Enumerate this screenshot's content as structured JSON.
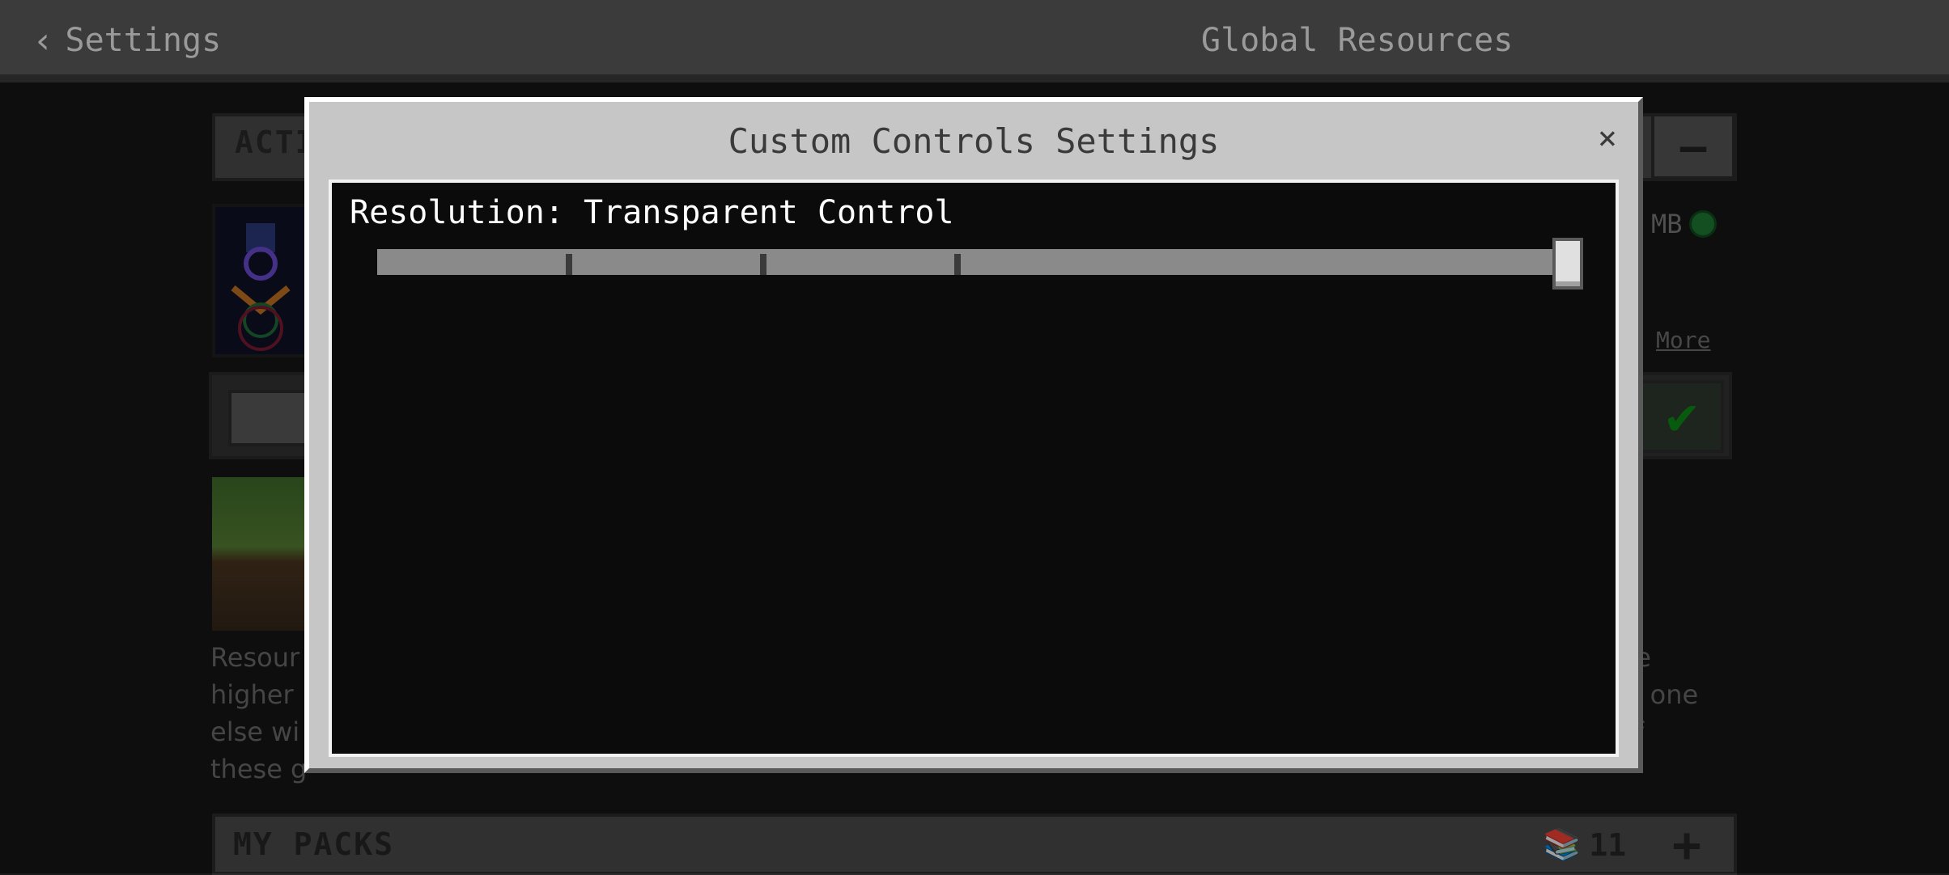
{
  "topbar": {
    "back_label": "Settings",
    "title": "Global Resources"
  },
  "background": {
    "active_header": "ACTI",
    "pack_size": "MB",
    "more_link": "More",
    "description_left": [
      "Resour",
      "higher",
      "else wi",
      "these g"
    ],
    "description_right": [
      "ne",
      "lo one",
      "of",
      ""
    ],
    "my_packs_label": "MY PACKS",
    "my_packs_count": "11"
  },
  "modal": {
    "title": "Custom Controls Settings",
    "close_glyph": "×",
    "setting": {
      "label": "Resolution: Transparent Control",
      "slider_steps": 5,
      "slider_value_fraction": 1.0
    }
  },
  "colors": {
    "modal_bg": "#c6c6c6",
    "modal_body": "#0b0b0b",
    "check_green": "#0d8a16"
  }
}
